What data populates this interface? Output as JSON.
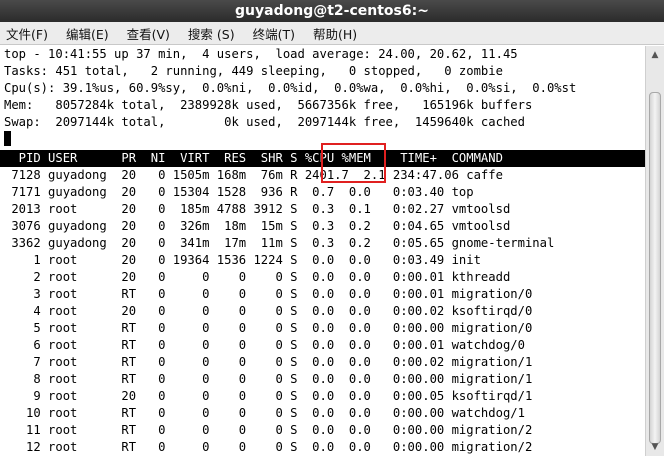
{
  "window": {
    "title": "guyadong@t2-centos6:~"
  },
  "menu": [
    "文件(F)",
    "编辑(E)",
    "查看(V)",
    "搜索 (S)",
    "终端(T)",
    "帮助(H)"
  ],
  "summary": [
    "top - 10:41:55 up 37 min,  4 users,  load average: 24.00, 20.62, 11.45",
    "Tasks: 451 total,   2 running, 449 sleeping,   0 stopped,   0 zombie",
    "Cpu(s): 39.1%us, 60.9%sy,  0.0%ni,  0.0%id,  0.0%wa,  0.0%hi,  0.0%si,  0.0%st",
    "Mem:   8057284k total,  2389928k used,  5667356k free,   165196k buffers",
    "Swap:  2097144k total,        0k used,  2097144k free,  1459640k cached"
  ],
  "table": {
    "header": "  PID USER      PR  NI  VIRT  RES  SHR S %CPU %MEM    TIME+  COMMAND",
    "rows": [
      " 7128 guyadong  20   0 1505m 168m  76m R 2401.7  2.1 234:47.06 caffe",
      " 7171 guyadong  20   0 15304 1528  936 R  0.7  0.0   0:03.40 top",
      " 2013 root      20   0  185m 4788 3912 S  0.3  0.1   0:02.27 vmtoolsd",
      " 3076 guyadong  20   0  326m  18m  15m S  0.3  0.2   0:04.65 vmtoolsd",
      " 3362 guyadong  20   0  341m  17m  11m S  0.3  0.2   0:05.65 gnome-terminal",
      "    1 root      20   0 19364 1536 1224 S  0.0  0.0   0:03.49 init",
      "    2 root      20   0     0    0    0 S  0.0  0.0   0:00.01 kthreadd",
      "    3 root      RT   0     0    0    0 S  0.0  0.0   0:00.01 migration/0",
      "    4 root      20   0     0    0    0 S  0.0  0.0   0:00.02 ksoftirqd/0",
      "    5 root      RT   0     0    0    0 S  0.0  0.0   0:00.00 migration/0",
      "    6 root      RT   0     0    0    0 S  0.0  0.0   0:00.01 watchdog/0",
      "    7 root      RT   0     0    0    0 S  0.0  0.0   0:00.02 migration/1",
      "    8 root      RT   0     0    0    0 S  0.0  0.0   0:00.00 migration/1",
      "    9 root      20   0     0    0    0 S  0.0  0.0   0:00.05 ksoftirqd/1",
      "   10 root      RT   0     0    0    0 S  0.0  0.0   0:00.00 watchdog/1",
      "   11 root      RT   0     0    0    0 S  0.0  0.0   0:00.00 migration/2",
      "   12 root      RT   0     0    0    0 S  0.0  0.0   0:00.00 migration/2"
    ]
  },
  "colors": {
    "highlight": "#e02020",
    "titlebar": "#2b2b2b",
    "header_bar": "#000000"
  }
}
